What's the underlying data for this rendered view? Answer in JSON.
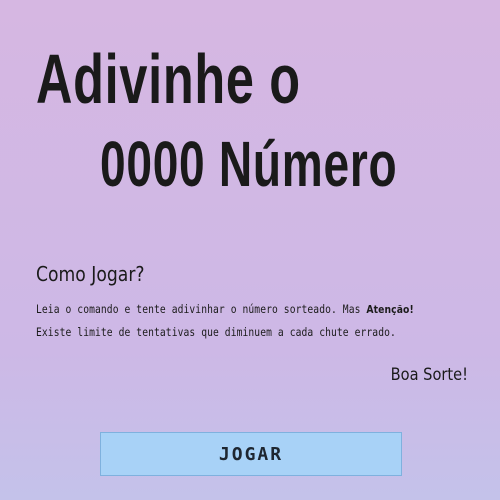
{
  "hero": {
    "title_line_1": "Adivinhe o",
    "title_line_2": "0000 Número"
  },
  "howto": {
    "title": "Como Jogar?",
    "text_line_1": "Leia o comando e tente adivinhar o número sorteado. Mas ",
    "text_alert": "Atenção!",
    "text_line_2": "Existe limite de tentativas que diminuem a cada chute errado.",
    "good_luck": "Boa Sorte!"
  },
  "actions": {
    "play_label": "JOGAR"
  },
  "colors": {
    "background_top": "#d6b7e2",
    "background_bottom": "#c4c2ea",
    "button_fill": "#a8d2f7",
    "button_border": "#7fb1de",
    "text": "#1b1b1b"
  }
}
